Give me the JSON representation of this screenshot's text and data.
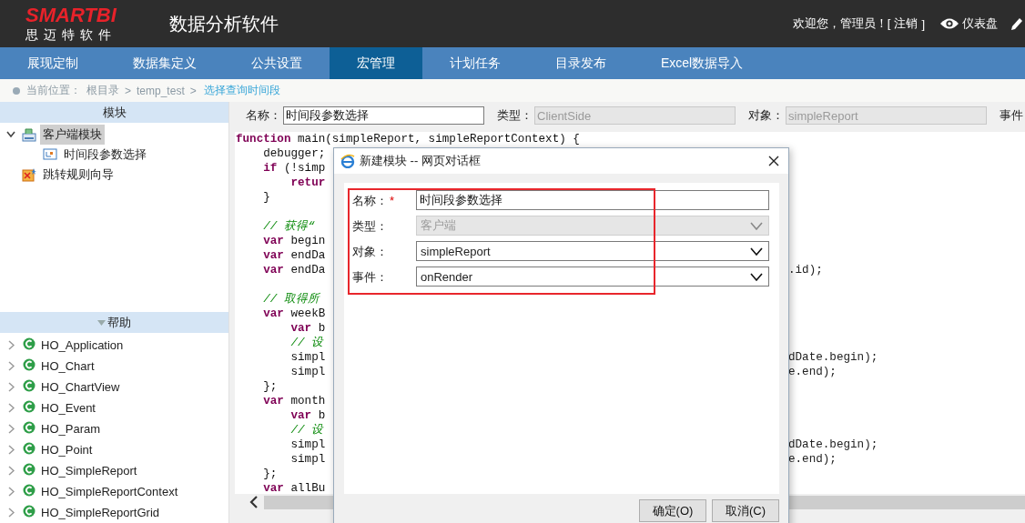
{
  "header": {
    "brand": "SMARTBI",
    "brand_subtitle": "思 迈 特 软 件",
    "app_title": "数据分析软件",
    "welcome": "欢迎您，管理员！[",
    "logout": "注销",
    "welcome_end": "]",
    "dashboard": "仪表盘"
  },
  "nav": [
    {
      "label": "展现定制",
      "selected": false
    },
    {
      "label": "数据集定义",
      "selected": false
    },
    {
      "label": "公共设置",
      "selected": false
    },
    {
      "label": "宏管理",
      "selected": true
    },
    {
      "label": "计划任务",
      "selected": false
    },
    {
      "label": "目录发布",
      "selected": false
    },
    {
      "label": "Excel数据导入",
      "selected": false
    }
  ],
  "breadcrumb": {
    "label": "当前位置：",
    "crumbs": [
      "根目录",
      ">",
      "temp_test",
      ">"
    ],
    "current": "选择查询时间段"
  },
  "module_panel": {
    "title": "模块",
    "tree": [
      {
        "label": "客户端模块",
        "kind": "module",
        "expanded": true,
        "selected": true,
        "children": [
          {
            "label": "时间段参数选择",
            "kind": "macro",
            "selected": false
          }
        ]
      },
      {
        "label": "跳转规则向导",
        "kind": "wizard",
        "selected": false
      }
    ]
  },
  "help_panel": {
    "title": "帮助",
    "items": [
      {
        "label": "HO_Application",
        "expanded": false
      },
      {
        "label": "HO_Chart",
        "expanded": false
      },
      {
        "label": "HO_ChartView",
        "expanded": false
      },
      {
        "label": "HO_Event",
        "expanded": false
      },
      {
        "label": "HO_Param",
        "expanded": false
      },
      {
        "label": "HO_Point",
        "expanded": false
      },
      {
        "label": "HO_SimpleReport",
        "expanded": false
      },
      {
        "label": "HO_SimpleReportContext",
        "expanded": false
      },
      {
        "label": "HO_SimpleReportGrid",
        "expanded": false
      }
    ]
  },
  "form": {
    "fields": [
      {
        "label": "名称：",
        "value": "时间段参数选择",
        "disabled": false
      },
      {
        "label": "类型：",
        "value": "ClientSide",
        "disabled": true
      },
      {
        "label": "对象：",
        "value": "simpleReport",
        "disabled": true
      },
      {
        "label": "事件"
      }
    ]
  },
  "code": {
    "lines": [
      {
        "full": true,
        "tokens": [
          {
            "kind": "kw",
            "text": "function"
          },
          {
            "kind": "plain",
            "text": " main(simpleReport, simpleReportContext) {"
          }
        ]
      },
      {
        "tokens": [
          {
            "kind": "plain",
            "text": "    debugger;"
          }
        ]
      },
      {
        "tokens": [
          {
            "kind": "kw",
            "text": "    if"
          },
          {
            "kind": "plain",
            "text": " (!simp"
          }
        ]
      },
      {
        "tokens": [
          {
            "kind": "kw",
            "text": "        retur"
          }
        ]
      },
      {
        "tokens": [
          {
            "kind": "plain",
            "text": "    }"
          }
        ]
      },
      {
        "blank": true
      },
      {
        "tokens": [
          {
            "kind": "comment",
            "text": "    // 获得“"
          }
        ]
      },
      {
        "tokens": [
          {
            "kind": "kw",
            "text": "    var"
          },
          {
            "kind": "plain",
            "text": " begin"
          }
        ]
      },
      {
        "tokens": [
          {
            "kind": "kw",
            "text": "    var"
          },
          {
            "kind": "plain",
            "text": " endDa"
          }
        ]
      },
      {
        "tokens": [
          {
            "kind": "kw",
            "text": "    var"
          },
          {
            "kind": "plain",
            "text": " endDa"
          }
        ],
        "right": ".id);"
      },
      {
        "blank": true
      },
      {
        "tokens": [
          {
            "kind": "comment",
            "text": "    // 取得所"
          }
        ]
      },
      {
        "tokens": [
          {
            "kind": "kw",
            "text": "    var"
          },
          {
            "kind": "plain",
            "text": " weekB"
          }
        ]
      },
      {
        "tokens": [
          {
            "kind": "kw",
            "text": "        var"
          },
          {
            "kind": "plain",
            "text": " b"
          }
        ]
      },
      {
        "tokens": [
          {
            "kind": "comment",
            "text": "        // 设"
          }
        ]
      },
      {
        "tokens": [
          {
            "kind": "plain",
            "text": "        simpl"
          }
        ],
        "right": "dDate.begin);"
      },
      {
        "tokens": [
          {
            "kind": "plain",
            "text": "        simpl"
          }
        ],
        "right": "e.end);"
      },
      {
        "tokens": [
          {
            "kind": "plain",
            "text": "    };"
          }
        ]
      },
      {
        "tokens": [
          {
            "kind": "kw",
            "text": "    var"
          },
          {
            "kind": "plain",
            "text": " month"
          }
        ]
      },
      {
        "tokens": [
          {
            "kind": "kw",
            "text": "        var"
          },
          {
            "kind": "plain",
            "text": " b"
          }
        ]
      },
      {
        "tokens": [
          {
            "kind": "comment",
            "text": "        // 设"
          }
        ]
      },
      {
        "tokens": [
          {
            "kind": "plain",
            "text": "        simpl"
          }
        ],
        "right": "dDate.begin);"
      },
      {
        "tokens": [
          {
            "kind": "plain",
            "text": "        simpl"
          }
        ],
        "right": "e.end);"
      },
      {
        "tokens": [
          {
            "kind": "plain",
            "text": "    };"
          }
        ]
      },
      {
        "tokens": [
          {
            "kind": "kw",
            "text": "    var"
          },
          {
            "kind": "plain",
            "text": " allBu"
          }
        ]
      }
    ]
  },
  "dialog": {
    "title": "新建模块 -- 网页对话框",
    "fields": [
      {
        "label": "名称：",
        "mark": "*",
        "kind": "text",
        "value": "时间段参数选择",
        "disabled": false
      },
      {
        "label": "类型：",
        "kind": "select",
        "value": "客户端",
        "disabled": true
      },
      {
        "label": "对象：",
        "kind": "select",
        "value": "simpleReport",
        "disabled": false
      },
      {
        "label": "事件：",
        "kind": "select",
        "value": "onRender",
        "disabled": false
      }
    ],
    "buttons": [
      "确定(O)",
      "取消(C)"
    ]
  }
}
